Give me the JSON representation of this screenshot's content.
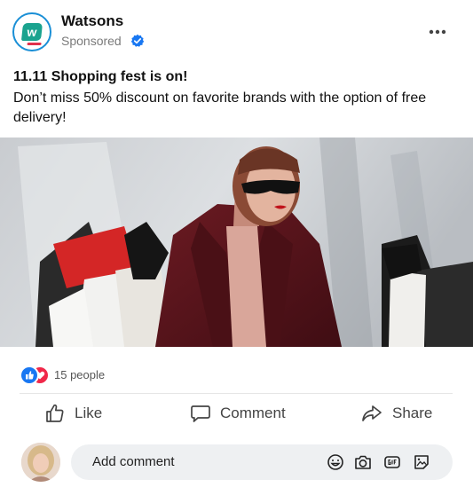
{
  "post": {
    "author": "Watsons",
    "logo_letter": "w",
    "sponsored_label": "Sponsored",
    "title": "11.11 Shopping fest is on!",
    "body": "Don’t miss 50% discount on favorite brands with the option of free delivery!"
  },
  "reactions": {
    "count_label": "15 people"
  },
  "actions": {
    "like_label": "Like",
    "comment_label": "Comment",
    "share_label": "Share"
  },
  "composer": {
    "placeholder": "Add comment"
  },
  "icons": {
    "more": "more-horizontal-icon",
    "verified": "verified-badge-icon",
    "like": "thumbs-up-icon",
    "comment": "speech-bubble-icon",
    "share": "share-arrow-icon",
    "emoji": "emoji-icon",
    "camera": "camera-icon",
    "gif": "gif-icon",
    "sticker": "sticker-icon"
  },
  "colors": {
    "brand_teal": "#1aa38f",
    "brand_red": "#e0304a",
    "verified_blue": "#1877f2",
    "love_red": "#f02849"
  }
}
